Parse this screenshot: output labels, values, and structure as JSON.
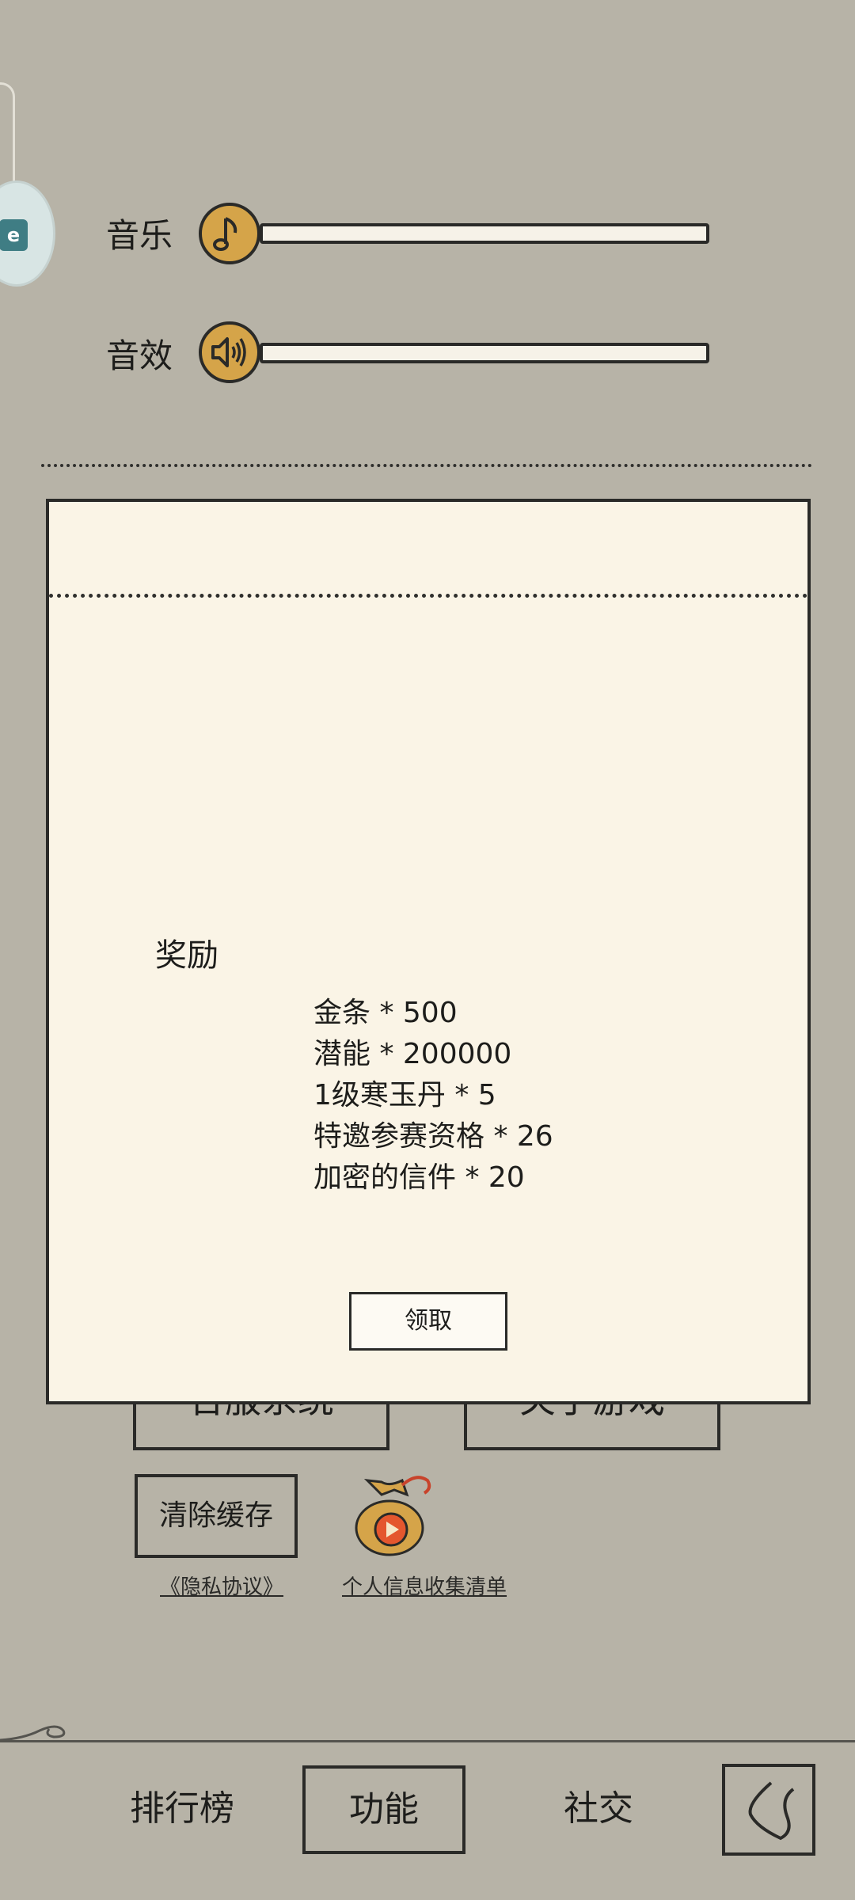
{
  "settings": {
    "music_label": "音乐",
    "sfx_label": "音效",
    "music_volume": 0,
    "sfx_volume": 0
  },
  "background": {
    "server_button_label": "合服系统",
    "about_button_label": "关于游戏",
    "clear_cache_label": "清除缓存",
    "privacy_link": "《隐私协议》",
    "personal_info_link": "个人信息收集清单"
  },
  "reward_dialog": {
    "title": "奖励",
    "items": [
      "金条  * 500",
      "潜能  * 200000",
      "1级寒玉丹  * 5",
      "特邀参赛资格  * 26",
      "加密的信件  * 20"
    ],
    "claim_label": "领取"
  },
  "nav": {
    "rank_label": "排行榜",
    "function_label": "功能",
    "social_label": "社交"
  },
  "colors": {
    "background": "#b7b3a7",
    "dialog": "#faf4e6",
    "knob": "#d5a449",
    "ink": "#2a2a28"
  }
}
